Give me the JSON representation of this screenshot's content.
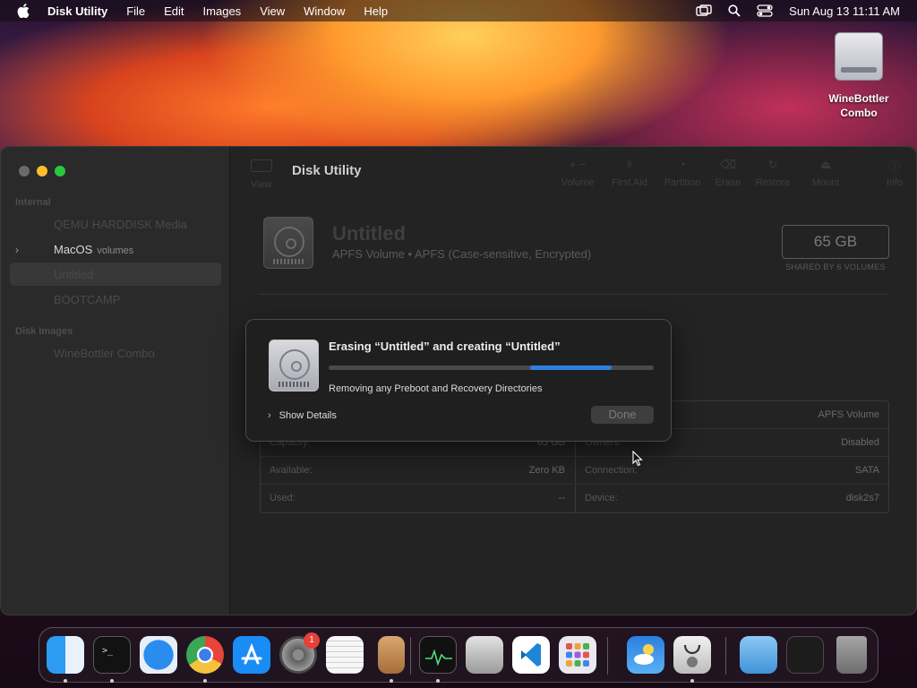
{
  "menubar": {
    "app_name": "Disk Utility",
    "menus": [
      "File",
      "Edit",
      "Images",
      "View",
      "Window",
      "Help"
    ],
    "clock": "Sun Aug 13  11:11 AM"
  },
  "desktop": {
    "icon_label_line1": "WineBottler",
    "icon_label_line2": "Combo"
  },
  "window": {
    "title": "Disk Utility",
    "toolbar": {
      "view": "View",
      "volume": "Volume",
      "first_aid": "First Aid",
      "partition": "Partition",
      "erase": "Erase",
      "restore": "Restore",
      "mount": "Mount",
      "info": "Info"
    },
    "sidebar": {
      "internal_header": "Internal",
      "disk_images_header": "Disk Images",
      "items": [
        {
          "label": "QEMU HARDDISK Media"
        },
        {
          "label": "MacOS",
          "sub": "volumes"
        },
        {
          "label": "Untitled"
        },
        {
          "label": "BOOTCAMP"
        },
        {
          "label": "WineBottler Combo"
        }
      ]
    },
    "volume": {
      "name": "Untitled",
      "description": "APFS Volume • APFS (Case-sensitive, Encrypted)",
      "size": "65 GB",
      "size_caption": "SHARED BY 6 VOLUMES"
    },
    "info_left": [
      {
        "k": "Capacity:",
        "v": "65 GB"
      },
      {
        "k": "Available:",
        "v": "Zero KB"
      },
      {
        "k": "Used:",
        "v": "--"
      }
    ],
    "info_right": [
      {
        "k": "",
        "v": "APFS Volume"
      },
      {
        "k": "Owners:",
        "v": "Disabled"
      },
      {
        "k": "Connection:",
        "v": "SATA"
      },
      {
        "k": "Device:",
        "v": "disk2s7"
      }
    ]
  },
  "dialog": {
    "heading": "Erasing “Untitled” and creating “Untitled”",
    "status": "Removing any Preboot and Recovery Directories",
    "show_details": "Show Details",
    "done_label": "Done",
    "progress_bar": {
      "segment_start": 0.62,
      "segment_end": 0.87
    }
  },
  "dock": {
    "system_preferences_badge": "1",
    "apps": [
      "Finder",
      "Terminal",
      "Safari",
      "Chrome",
      "App Store",
      "System Preferences",
      "TextEdit",
      "Archive Utility",
      "Activity Monitor",
      "Boot Camp Assistant",
      "Visual Studio Code",
      "Launchpad",
      "Weather",
      "Disk Utility",
      "Applications",
      "Recent Window",
      "Trash"
    ]
  },
  "colors": {
    "accent": "#2f7fe0",
    "close": "#ff5f57",
    "minimize": "#febc2e",
    "zoom": "#28c840"
  }
}
